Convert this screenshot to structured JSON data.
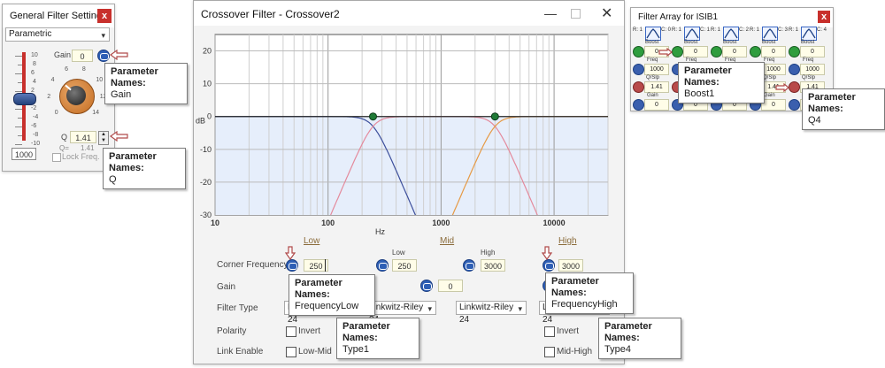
{
  "general": {
    "title": "General Filter Settings",
    "close": "x",
    "type_value": "Parametric",
    "slider_ticks": [
      "10",
      "8",
      "6",
      "4",
      "2",
      "0",
      "-2",
      "-4",
      "-6",
      "-8",
      "-10"
    ],
    "slider_value": "1000",
    "gain_label": "Gain",
    "gain_value": "0",
    "knob_ticks": [
      "0",
      "2",
      "4",
      "6",
      "8",
      "10",
      "12",
      "14"
    ],
    "q_label": "Q",
    "q_value": "1.41",
    "q_eq": "Q=",
    "q_eq_value": "1.41",
    "lock_label": "Lock Freq.",
    "tip_gain": {
      "title": "Parameter Names:",
      "value": "Gain"
    },
    "tip_q": {
      "title": "Parameter Names:",
      "value": "Q"
    }
  },
  "crossover": {
    "title": "Crossover Filter - Crossover2",
    "yticks": [
      "20",
      "10",
      "0",
      "-10",
      "-20",
      "-30"
    ],
    "xticks": [
      "10",
      "100",
      "1000",
      "10000"
    ],
    "ylabel": "dB",
    "xlabel": "Hz",
    "section_low": "Low",
    "section_mid": "Mid",
    "section_high": "High",
    "sub_low": "Low",
    "sub_high": "High",
    "corner_label": "Corner Frequency",
    "freq_low": "250",
    "freq_mid_low": "250",
    "freq_mid_high": "3000",
    "freq_high": "3000",
    "gain_label": "Gain",
    "gain_mid": "0",
    "filter_type_label": "Filter Type",
    "type_low": "Linkwitz-Riley 24",
    "type_mid_low": "Linkwitz-Riley 24",
    "type_mid_high": "Linkwitz-Riley 24",
    "type_high": "Linkwitz-Riley 24",
    "polarity_label": "Polarity",
    "invert_low": "Invert",
    "invert_high": "Invert",
    "link_label": "Link Enable",
    "link_low": "Low-Mid",
    "link_high": "Mid-High",
    "tip_freq_low": {
      "title": "Parameter Names:",
      "value": "FrequencyLow"
    },
    "tip_freq_high": {
      "title": "Parameter Names:",
      "value": "FrequencyHigh"
    },
    "tip_type1": {
      "title": "Parameter Names:",
      "value": "Type1"
    },
    "tip_type4": {
      "title": "Parameter Names:",
      "value": "Type4"
    }
  },
  "array": {
    "title": "Filter Array for ISIB1",
    "close": "x",
    "channel_labels": [
      "R: 1",
      "C: 0",
      "R: 1",
      "C: 1",
      "R: 1",
      "C: 2",
      "R: 1",
      "C: 3",
      "R: 1",
      "C: 4"
    ],
    "row_boost": "Boost",
    "boost_values": [
      "0",
      "0",
      "0",
      "0",
      "0"
    ],
    "row_freq": "Freq",
    "freq_values": [
      "1000",
      "1000",
      "1000",
      "1000",
      "1000"
    ],
    "row_qslp": "Q/Slp",
    "q_values": [
      "1.41",
      "1.41",
      "1.41",
      "1.41",
      "1.41"
    ],
    "row_gain": "Gain",
    "gain_values": [
      "0",
      "0",
      "0",
      "0",
      "0"
    ],
    "tip_boost": {
      "title": "Parameter Names:",
      "value": "Boost1"
    },
    "tip_q4": {
      "title": "Parameter Names:",
      "value": "Q4"
    }
  },
  "colors": {
    "curve_low": "#3d4f9c",
    "curve_mid": "#e48a9c",
    "curve_high": "#e69a45",
    "plot_fill": "#e6eefb"
  }
}
